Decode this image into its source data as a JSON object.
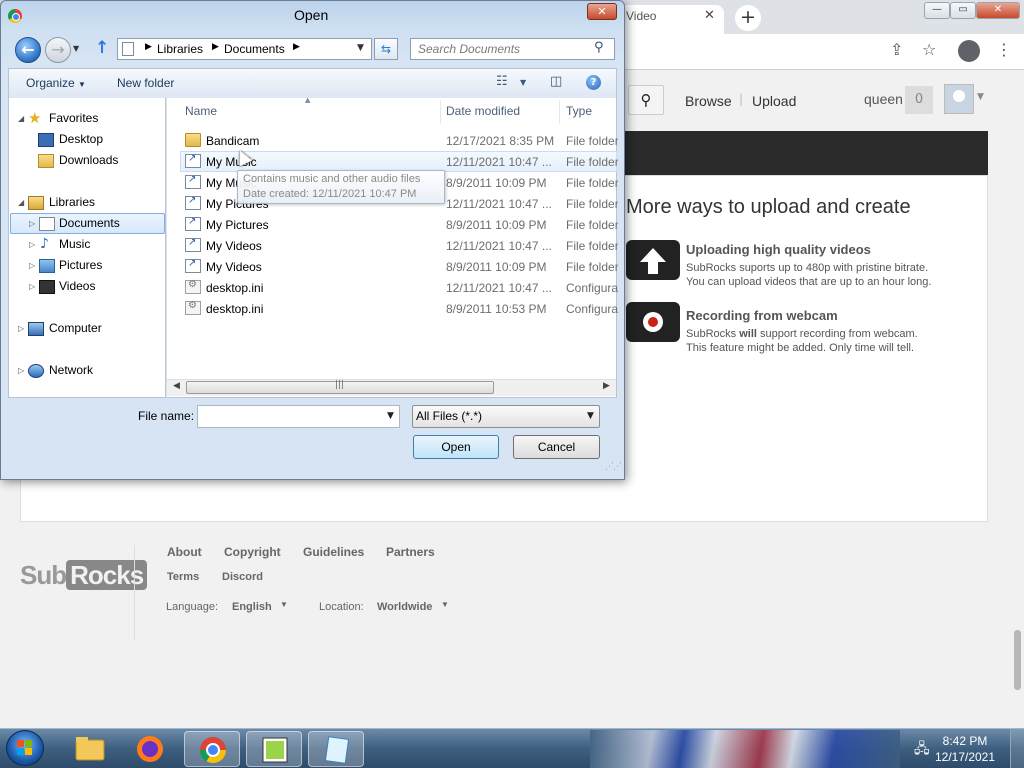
{
  "browser": {
    "tab_title": "Video",
    "tab_close": "✕",
    "new_tab": "+",
    "win_min": "—",
    "win_max": "▭",
    "win_close": "✕",
    "share_icon": "share-icon",
    "star_icon": "star-icon",
    "menu_icon": "⋮"
  },
  "site": {
    "nav_browse": "Browse",
    "nav_upload": "Upload",
    "nav_sep": "|",
    "username": "queen",
    "inbox_count": "0",
    "section_title": "More ways to upload and create",
    "features": [
      {
        "title": "Uploading high quality videos",
        "desc1": "SubRocks suports up to 480p with pristine bitrate.",
        "desc2": "You can upload videos that are up to an hour long."
      },
      {
        "title": "Recording from webcam",
        "desc1_a": "SubRocks ",
        "desc1_b": "will",
        "desc1_c": " support recording from webcam.",
        "desc2": "This feature might be added. Only time will tell."
      }
    ],
    "footer": {
      "logo_sub": "Sub",
      "logo_rocks": "Rocks",
      "links": [
        "About",
        "Copyright",
        "Guidelines",
        "Partners"
      ],
      "links2": [
        "Terms",
        "Discord"
      ],
      "language_label": "Language:",
      "language_value": "English",
      "location_label": "Location:",
      "location_value": "Worldwide"
    }
  },
  "dialog": {
    "title": "Open",
    "close": "✕",
    "breadcrumb": [
      "Libraries",
      "Documents"
    ],
    "search_placeholder": "Search Documents",
    "organize": "Organize",
    "new_folder": "New folder",
    "help": "?",
    "tree": {
      "favorites": "Favorites",
      "desktop": "Desktop",
      "downloads": "Downloads",
      "libraries": "Libraries",
      "documents": "Documents",
      "music": "Music",
      "pictures": "Pictures",
      "videos": "Videos",
      "computer": "Computer",
      "network": "Network"
    },
    "columns": [
      "Name",
      "Date modified",
      "Type"
    ],
    "files": [
      {
        "name": "Bandicam",
        "date": "12/17/2021 8:35 PM",
        "type": "File folder",
        "icon": "folder"
      },
      {
        "name": "My Music",
        "date": "12/11/2021 10:47 ...",
        "type": "File folder",
        "icon": "shortcut"
      },
      {
        "name": "My Music",
        "date": "8/9/2011 10:09 PM",
        "type": "File folder",
        "icon": "shortcut"
      },
      {
        "name": "My Pictures",
        "date": "12/11/2021 10:47 ...",
        "type": "File folder",
        "icon": "shortcut"
      },
      {
        "name": "My Pictures",
        "date": "8/9/2011 10:09 PM",
        "type": "File folder",
        "icon": "shortcut"
      },
      {
        "name": "My Videos",
        "date": "12/11/2021 10:47 ...",
        "type": "File folder",
        "icon": "shortcut"
      },
      {
        "name": "My Videos",
        "date": "8/9/2011 10:09 PM",
        "type": "File folder",
        "icon": "shortcut"
      },
      {
        "name": "desktop.ini",
        "date": "12/11/2021 10:47 ...",
        "type": "Configura",
        "icon": "ini"
      },
      {
        "name": "desktop.ini",
        "date": "8/9/2011 10:53 PM",
        "type": "Configura",
        "icon": "ini"
      }
    ],
    "tooltip": {
      "line1": "Contains music and other audio files",
      "line2": "Date created: 12/11/2021 10:47 PM"
    },
    "file_name_label": "File name:",
    "file_name_value": "",
    "file_type": "All Files (*.*)",
    "open_button": "Open",
    "cancel_button": "Cancel"
  },
  "taskbar": {
    "time": "8:42 PM",
    "date": "12/17/2021"
  }
}
